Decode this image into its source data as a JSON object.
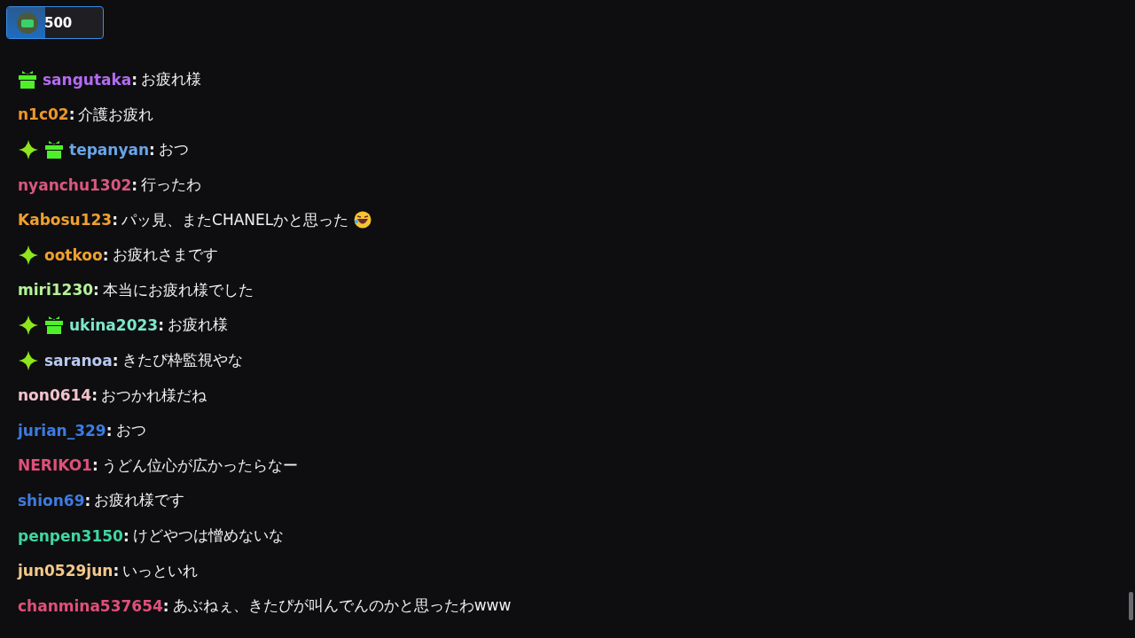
{
  "points_badge": {
    "value": "500",
    "level": 0.4
  },
  "messages": [
    {
      "badges": [
        {
          "kind": "gift"
        }
      ],
      "user": "sangutaka",
      "sep": ":",
      "color": "#b36bf2",
      "text": "お疲れ様"
    },
    {
      "user": "n1c02",
      "sep": ":",
      "color": "#f0962c",
      "text": "介護お疲れ"
    },
    {
      "badges": [
        {
          "kind": "sparkle"
        },
        {
          "kind": "gift"
        }
      ],
      "user": "tepanyan",
      "sep": ":",
      "color": "#6aa5e8",
      "text": "おつ"
    },
    {
      "user": "nyanchu1302",
      "sep": ":",
      "color": "#d9587f",
      "text": "行ったわ"
    },
    {
      "user": "Kabosu123",
      "sep": ":",
      "color": "#f0a030",
      "text": "パッ見、またCHANELかと思った",
      "end_emoji": true
    },
    {
      "badges": [
        {
          "kind": "sparkle"
        }
      ],
      "user": "ootkoo",
      "sep": ":",
      "color": "#f0a030",
      "text": "お疲れさまです"
    },
    {
      "user": "miri1230",
      "sep": ":",
      "color": "#b6f29a",
      "text": "本当にお疲れ様でした"
    },
    {
      "badges": [
        {
          "kind": "sparkle"
        },
        {
          "kind": "gift"
        }
      ],
      "user": "ukina2023",
      "sep": ":",
      "color": "#7de8c8",
      "text": "お疲れ様"
    },
    {
      "badges": [
        {
          "kind": "sparkle"
        }
      ],
      "user": "saranoa",
      "sep": ":",
      "color": "#b8c8f0",
      "text": "きたぴ枠監視やな"
    },
    {
      "user": "non0614",
      "sep": ":",
      "color": "#f2c2cc",
      "text": "おつかれ様だね"
    },
    {
      "user": "jurian_329",
      "sep": ":",
      "color": "#3d7be0",
      "text": "おつ"
    },
    {
      "user": "NERIKO1",
      "sep": ":",
      "color": "#e0507a",
      "text": "うどん位心が広かったらなー"
    },
    {
      "user": "shion69",
      "sep": ":",
      "color": "#3d7be0",
      "text": "お疲れ様です"
    },
    {
      "user": "penpen3150",
      "sep": ":",
      "color": "#3fd6a0",
      "text": "けどやつは憎めないな"
    },
    {
      "user": "jun0529jun",
      "sep": ":",
      "color": "#f5c98a",
      "text": "いっといれ"
    },
    {
      "user": "chanmina537654",
      "sep": ":",
      "color": "#e0507a",
      "text": "あぶねぇ、きたぴが叫んでんのかと思ったわwww"
    }
  ]
}
